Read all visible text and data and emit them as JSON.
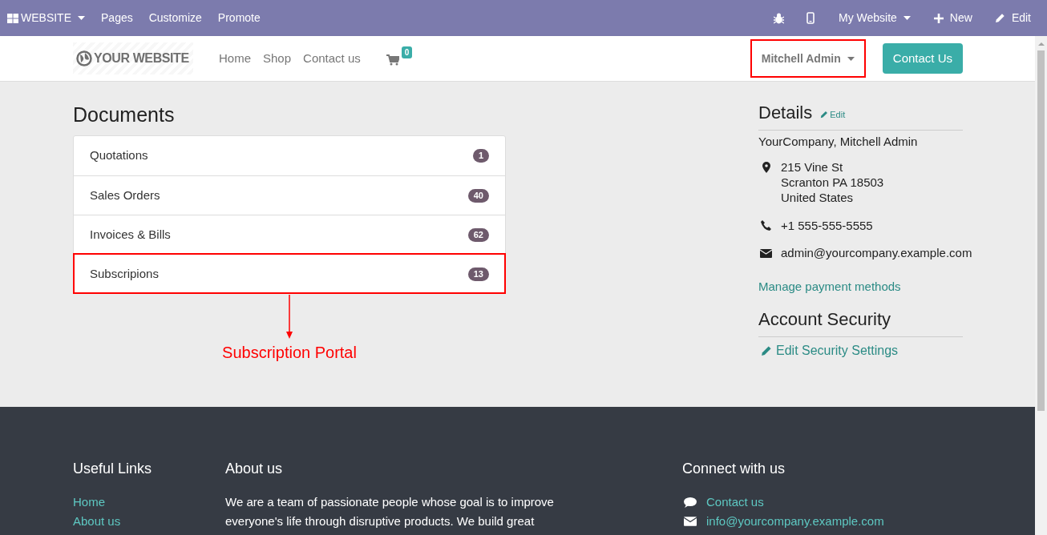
{
  "admin_bar": {
    "app_menu": "WEBSITE",
    "menu": [
      "Pages",
      "Customize",
      "Promote"
    ],
    "website_switcher": "My Website",
    "new_button": "New",
    "edit_button": "Edit"
  },
  "navbar": {
    "logo": "YOUR WEBSITE",
    "links": [
      "Home",
      "Shop",
      "Contact us"
    ],
    "cart_count": "0",
    "user_menu": "Mitchell Admin",
    "user_menu_highlighted": true,
    "cta_button": "Contact Us"
  },
  "documents": {
    "title": "Documents",
    "items": [
      {
        "label": "Quotations",
        "count": "1",
        "highlighted": false
      },
      {
        "label": "Sales Orders",
        "count": "40",
        "highlighted": false
      },
      {
        "label": "Invoices & Bills",
        "count": "62",
        "highlighted": false
      },
      {
        "label": "Subscripions",
        "count": "13",
        "highlighted": true
      }
    ]
  },
  "annotation": "Subscription Portal",
  "details": {
    "title": "Details",
    "edit_link": "Edit",
    "name": "YourCompany, Mitchell Admin",
    "address": [
      "215 Vine St",
      "Scranton PA 18503",
      "United States"
    ],
    "phone": "+1 555-555-5555",
    "email": "admin@yourcompany.example.com",
    "payment_link": "Manage payment methods"
  },
  "security": {
    "title": "Account Security",
    "link": "Edit Security Settings"
  },
  "footer": {
    "useful_links": {
      "title": "Useful Links",
      "links": [
        "Home",
        "About us"
      ]
    },
    "about": {
      "title": "About us",
      "lines": [
        "We are a team of passionate people whose goal is to improve",
        "everyone's life through disruptive products. We build great"
      ]
    },
    "connect": {
      "title": "Connect with us",
      "items": [
        {
          "kind": "chat",
          "label": "Contact us"
        },
        {
          "kind": "email",
          "label": "info@yourcompany.example.com"
        }
      ]
    }
  }
}
